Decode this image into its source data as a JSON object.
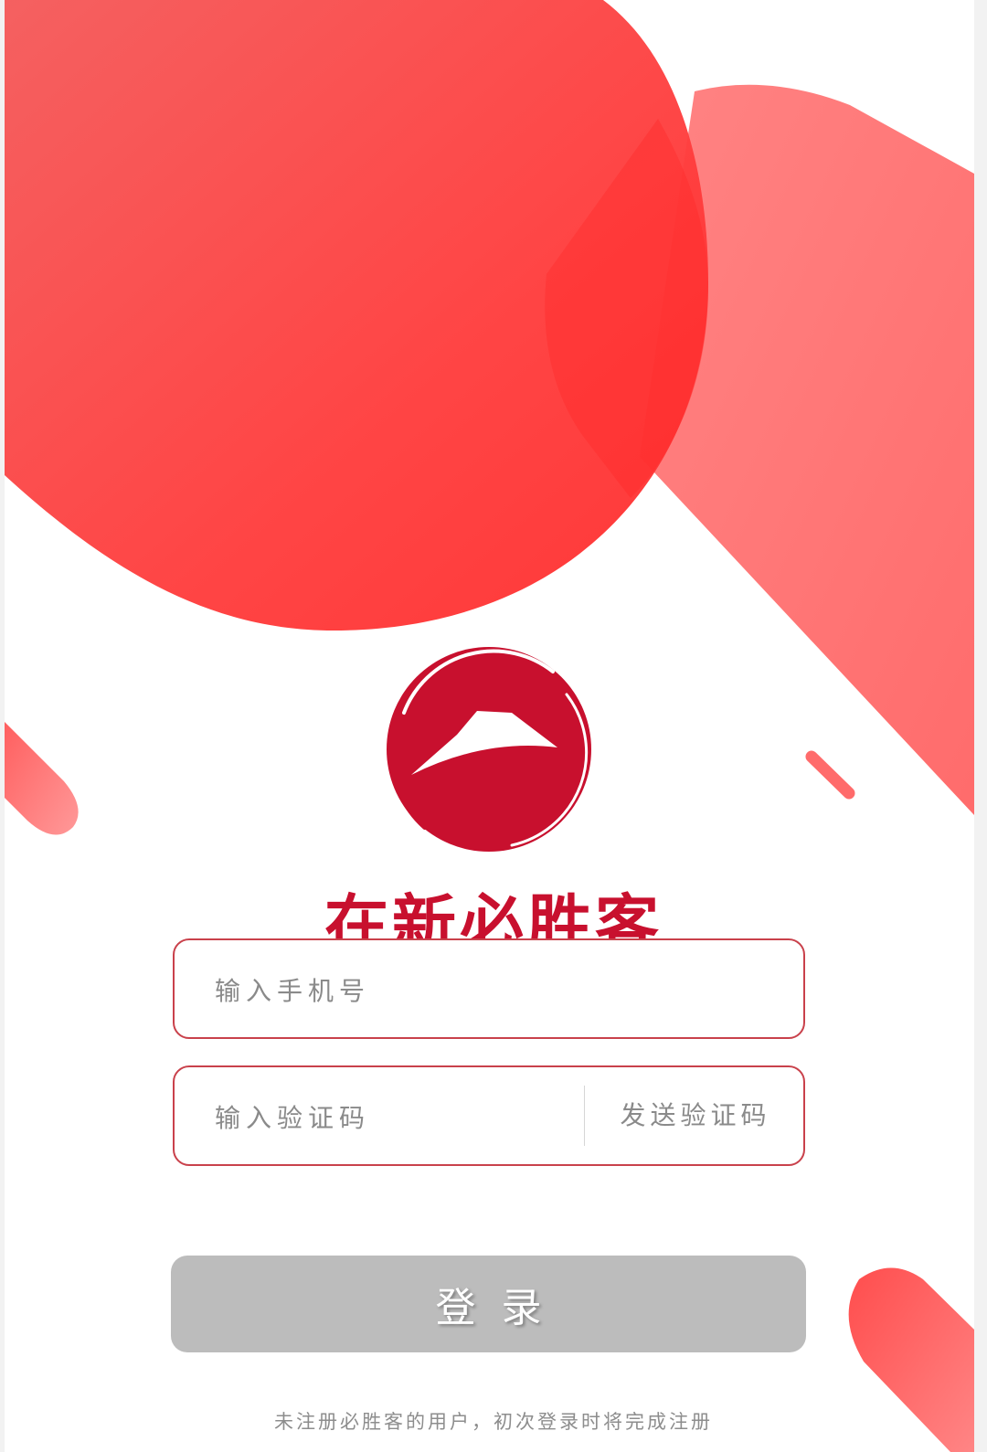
{
  "brand": {
    "title": "在新必胜客"
  },
  "login_form": {
    "phone_placeholder": "输入手机号",
    "code_placeholder": "输入验证码",
    "send_code_label": "发送验证码",
    "login_label": "登录"
  },
  "footer": {
    "register_note": "未注册必胜客的用户，初次登录时将完成注册"
  },
  "colors": {
    "brand_red": "#c8102e",
    "accent_red": "#ff3b3b",
    "button_disabled": "#bcbcbc",
    "field_border": "#c9414b"
  },
  "icons": {
    "logo": "pizza-hut-roof-logo"
  }
}
